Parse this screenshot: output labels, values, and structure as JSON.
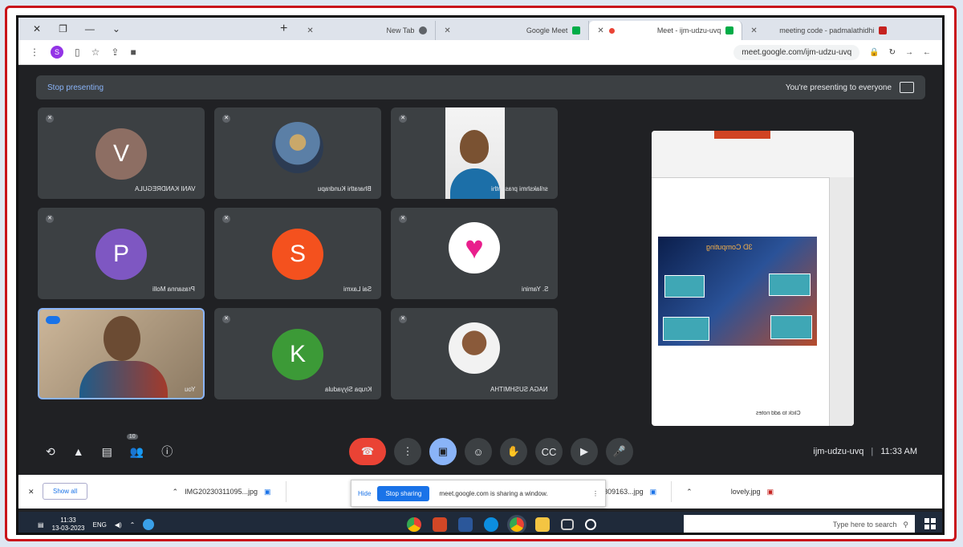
{
  "browser": {
    "tabs": [
      {
        "label": "meeting code - padmalathidhi",
        "favicon_color": "#4285f4"
      },
      {
        "label": "Meet - ijm-udzu-uvq",
        "favicon_color": "#00ac47",
        "active": true
      },
      {
        "label": "Google Meet",
        "favicon_color": "#00ac47"
      },
      {
        "label": "New Tab",
        "favicon_color": "#5f6368"
      }
    ],
    "url": "meet.google.com/ijm-udzu-uvq",
    "profile_initial": "S"
  },
  "meet": {
    "banner_message": "You're presenting to everyone",
    "stop_presenting": "Stop presenting",
    "participants": [
      {
        "name": "srilakshmi prasanthi",
        "type": "photo"
      },
      {
        "name": "Bharathi Kundrapu",
        "type": "photo"
      },
      {
        "name": "VANI KANDREGULA",
        "initial": "V",
        "color": "#8d6e63"
      },
      {
        "name": "S. Yamini",
        "type": "photo"
      },
      {
        "name": "Sai Laxmi",
        "initial": "S",
        "color": "#f4511e"
      },
      {
        "name": "Prasanna Molli",
        "initial": "P",
        "color": "#7e57c2"
      },
      {
        "name": "NAGA SUSHMITHA",
        "type": "photo"
      },
      {
        "name": "Krupa Siyyadula",
        "initial": "K",
        "color": "#3c9a37"
      },
      {
        "name": "You",
        "type": "self"
      }
    ],
    "meeting_time": "11:33 AM",
    "meeting_code": "ijm-udzu-uvq",
    "people_count": "10",
    "slide": {
      "title": "3D Computing",
      "caption": "Click to add notes"
    }
  },
  "download_shelf": {
    "items": [
      {
        "name": "lovely.jpg"
      },
      {
        "name": "IMG20230309163...jpg"
      },
      {
        "name": "IMG20230311095...jpg"
      }
    ],
    "show_all": "Show all"
  },
  "share_notice": {
    "text": "meet.google.com is sharing a window.",
    "stop_button": "Stop sharing",
    "hide_button": "Hide"
  },
  "taskbar": {
    "search_placeholder": "Type here to search",
    "time": "11:33",
    "date": "13-03-2023",
    "lang": "ENG"
  }
}
